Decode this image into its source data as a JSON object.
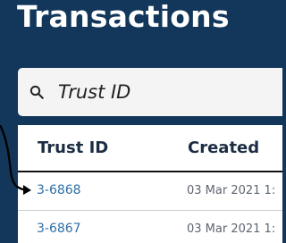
{
  "page": {
    "title": "Transactions"
  },
  "search": {
    "placeholder": "Trust ID",
    "icon": "search-icon"
  },
  "table": {
    "columns": [
      "Trust ID",
      "Created"
    ],
    "rows": [
      {
        "trust_id": "3-6868",
        "created": "03 Mar 2021 1:"
      },
      {
        "trust_id": "3-6867",
        "created": "03 Mar 2021 1:"
      }
    ]
  },
  "annotation": {
    "icon": "curved-arrow-icon",
    "color": "#000000"
  },
  "colors": {
    "background": "#13375a",
    "link": "#2e6fa7",
    "header_text": "#1c2d43"
  }
}
